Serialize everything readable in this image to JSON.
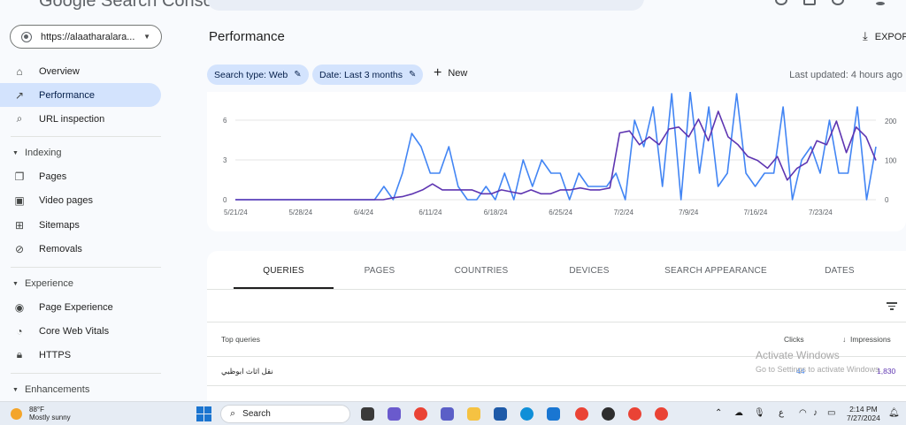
{
  "header": {
    "logo_text": "Google Search Console"
  },
  "sidebar": {
    "property": "https://alaatharalara...",
    "items": [
      {
        "label": "Overview",
        "icon": "home-icon"
      },
      {
        "label": "Performance",
        "icon": "trend-icon",
        "active": true
      },
      {
        "label": "URL inspection",
        "icon": "search-icon"
      }
    ],
    "indexing": {
      "heading": "Indexing",
      "items": [
        {
          "label": "Pages",
          "icon": "pages-icon"
        },
        {
          "label": "Video pages",
          "icon": "video-pages-icon"
        },
        {
          "label": "Sitemaps",
          "icon": "sitemap-icon"
        },
        {
          "label": "Removals",
          "icon": "removals-icon"
        }
      ]
    },
    "experience": {
      "heading": "Experience",
      "items": [
        {
          "label": "Page Experience",
          "icon": "page-experience-icon"
        },
        {
          "label": "Core Web Vitals",
          "icon": "speedometer-icon"
        },
        {
          "label": "HTTPS",
          "icon": "lock-icon"
        }
      ]
    },
    "enhancements": {
      "heading": "Enhancements"
    }
  },
  "main": {
    "title": "Performance",
    "export_label": "EXPORT",
    "filters": [
      "Search type: Web",
      "Date: Last 3 months"
    ],
    "new_label": "New",
    "last_updated": "Last updated: 4 hours ago"
  },
  "chart_data": {
    "type": "line",
    "x_ticks": [
      "5/21/24",
      "5/28/24",
      "6/4/24",
      "6/11/24",
      "6/18/24",
      "6/25/24",
      "7/2/24",
      "7/9/24",
      "7/16/24",
      "7/23/24"
    ],
    "y_left_ticks": [
      "0",
      "3",
      "6"
    ],
    "y_right_ticks": [
      "0",
      "100",
      "200"
    ],
    "ylim_left": [
      0,
      8
    ],
    "ylim_right": [
      0,
      270
    ],
    "series": [
      {
        "axis": "left",
        "color": "#4285f4",
        "values": [
          0,
          0,
          0,
          0,
          0,
          0,
          0,
          0,
          0,
          0,
          0,
          0,
          0,
          0,
          0,
          0,
          1,
          0,
          2,
          5,
          4,
          2,
          2,
          4,
          1,
          0,
          0,
          1,
          0,
          2,
          0,
          3,
          1,
          3,
          2,
          2,
          0,
          2,
          1,
          1,
          1,
          2,
          0,
          6,
          4,
          7,
          1,
          8,
          0,
          9,
          2,
          7,
          1,
          2,
          8,
          2,
          1,
          2,
          2,
          7,
          0,
          3,
          4,
          2,
          6,
          2,
          2,
          7,
          0,
          4
        ],
        "highlight": [
          null,
          null,
          null,
          null,
          null,
          null,
          null,
          null,
          null,
          null,
          null,
          null,
          null,
          null,
          null,
          null,
          null,
          null,
          null,
          null,
          null,
          null,
          null,
          null,
          null,
          null,
          null,
          null,
          null,
          null,
          null,
          null,
          null,
          null,
          null,
          null,
          null,
          null,
          null,
          null,
          null,
          null,
          null,
          null,
          null,
          null,
          null,
          null,
          null,
          null,
          null,
          null,
          null,
          null,
          null,
          null,
          null,
          null,
          null,
          null,
          null,
          null,
          null,
          null,
          null,
          null,
          null,
          null,
          null,
          null
        ]
      },
      {
        "axis": "right",
        "color": "#5e35b1",
        "values": [
          0,
          0,
          0,
          0,
          0,
          0,
          0,
          0,
          0,
          0,
          0,
          0,
          0,
          0,
          0,
          0,
          5,
          8,
          15,
          25,
          40,
          25,
          25,
          25,
          25,
          15,
          15,
          25,
          20,
          15,
          25,
          15,
          15,
          25,
          25,
          30,
          25,
          25,
          30,
          170,
          175,
          140,
          160,
          140,
          180,
          185,
          160,
          205,
          150,
          225,
          160,
          140,
          110,
          100,
          80,
          110,
          50,
          80,
          95,
          150,
          140,
          200,
          120,
          185,
          160,
          100
        ]
      }
    ]
  },
  "table": {
    "tabs": [
      "QUERIES",
      "PAGES",
      "COUNTRIES",
      "DEVICES",
      "SEARCH APPEARANCE",
      "DATES"
    ],
    "columns": {
      "query": "Top queries",
      "clicks": "Clicks",
      "impressions": "Impressions"
    },
    "rows": [
      {
        "query": "نقل اثاث ابوظبي",
        "clicks": "44",
        "impressions": "1,830"
      }
    ],
    "watermark_title": "Activate Windows",
    "watermark_sub": "Go to Settings to activate Windows."
  },
  "taskbar": {
    "temp": "88°F",
    "condition": "Mostly sunny",
    "search_label": "Search",
    "time": "2:14 PM",
    "date": "7/27/2024"
  }
}
